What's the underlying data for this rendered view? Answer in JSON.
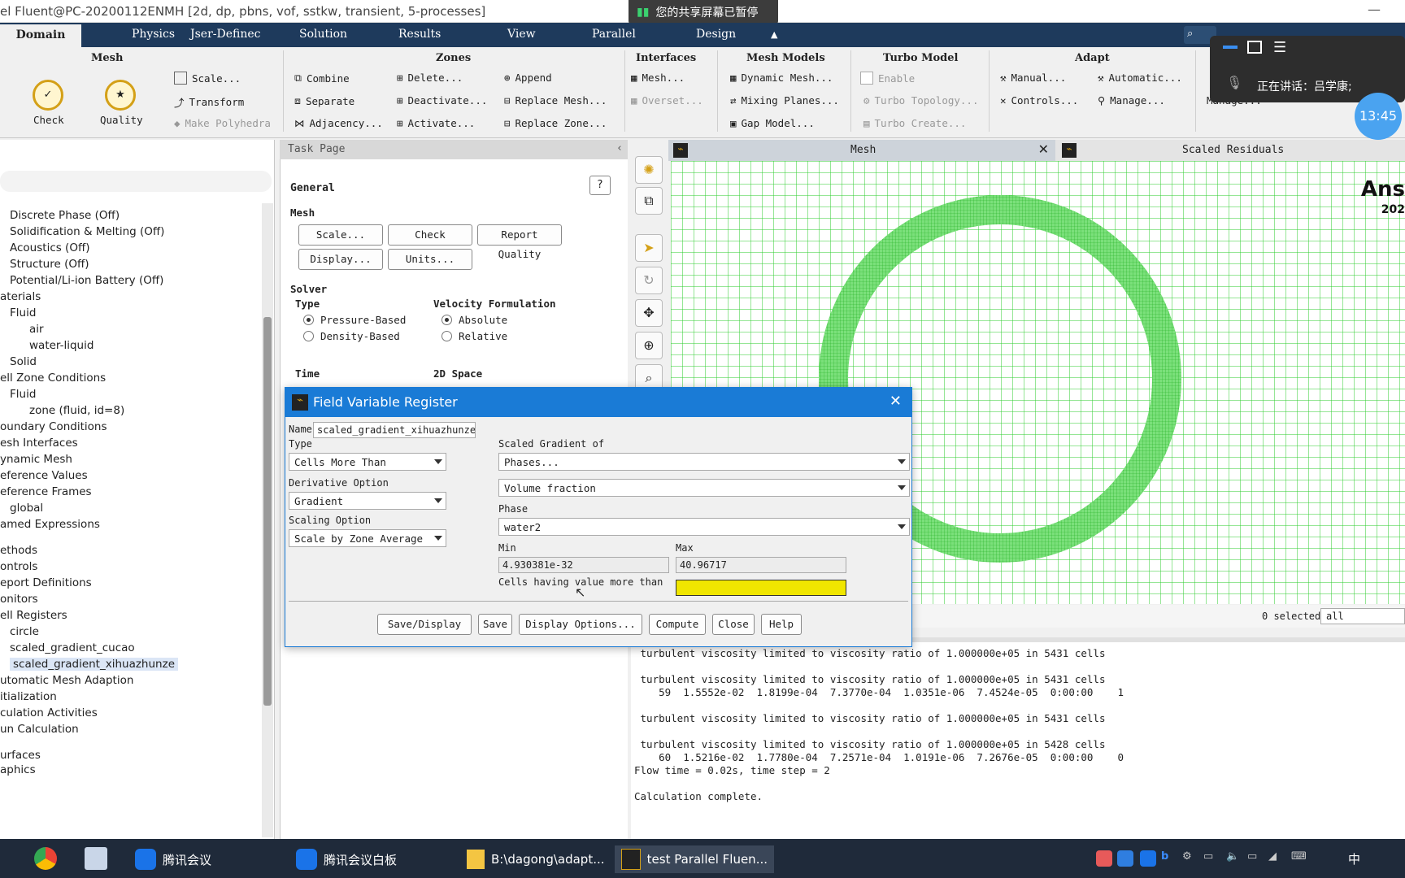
{
  "window": {
    "title": "el Fluent@PC-20200112ENMH  [2d, dp, pbns, vof, sstkw, transient, 5-processes]"
  },
  "share_banner": "您的共享屏幕已暂停",
  "menu": {
    "items": [
      "Domain",
      "Physics",
      "Jser-Definec",
      "Solution",
      "Results",
      "View",
      "Parallel",
      "Design"
    ]
  },
  "ribbon": {
    "mesh": {
      "title": "Mesh",
      "check": "Check",
      "quality": "Quality",
      "scale": "Scale...",
      "transform": "Transform",
      "make_polyhedra": "Make Polyhedra"
    },
    "zones": {
      "title": "Zones",
      "combine": "Combine",
      "separate": "Separate",
      "adjacency": "Adjacency...",
      "delete": "Delete...",
      "deactivate": "Deactivate...",
      "activate": "Activate...",
      "append": "Append",
      "replace_mesh": "Replace Mesh...",
      "replace_zone": "Replace Zone..."
    },
    "interfaces": {
      "title": "Interfaces",
      "mesh": "Mesh...",
      "overset": "Overset..."
    },
    "mesh_models": {
      "title": "Mesh Models",
      "dynamic": "Dynamic Mesh...",
      "mixing": "Mixing Planes...",
      "gap": "Gap Model..."
    },
    "turbo": {
      "title": "Turbo Model",
      "enable": "Enable",
      "topology": "Turbo Topology...",
      "create": "Turbo Create..."
    },
    "adapt": {
      "title": "Adapt",
      "manual": "Manual...",
      "automatic": "Automatic...",
      "controls": "Controls...",
      "manage": "Manage...",
      "manage2": "Manage..."
    }
  },
  "overlay": {
    "speaking": "正在讲话：吕学康;",
    "clock": "13:45"
  },
  "tree": {
    "items": [
      "Discrete Phase (Off)",
      "Solidification & Melting (Off)",
      "Acoustics (Off)",
      "Structure (Off)",
      "Potential/Li-ion Battery (Off)",
      "aterials",
      "Fluid",
      "air",
      "water-liquid",
      "Solid",
      "ell Zone Conditions",
      "Fluid",
      "zone (fluid, id=8)",
      "oundary Conditions",
      "esh Interfaces",
      "ynamic Mesh",
      "eference Values",
      "eference Frames",
      "global",
      "amed Expressions",
      "ethods",
      "ontrols",
      "eport Definitions",
      "onitors",
      "ell Registers",
      "circle",
      "scaled_gradient_cucao",
      "scaled_gradient_xihuazhunze",
      "utomatic Mesh Adaption",
      "itialization",
      "culation Activities",
      "un Calculation",
      "urfaces",
      "aphics"
    ]
  },
  "task": {
    "header": "Task Page",
    "general": "General",
    "mesh_label": "Mesh",
    "buttons": {
      "scale": "Scale...",
      "check": "Check",
      "report_quality": "Report Quality",
      "display": "Display...",
      "units": "Units..."
    },
    "solver": "Solver",
    "type": "Type",
    "pressure_based": "Pressure-Based",
    "density_based": "Density-Based",
    "velocity_formulation": "Velocity Formulation",
    "absolute": "Absolute",
    "relative": "Relative",
    "time": "Time",
    "space": "2D Space"
  },
  "graphics": {
    "tab_mesh": "Mesh",
    "tab_residuals": "Scaled Residuals",
    "brand": "Ans",
    "brand_sub": "202",
    "selected": "0 selected",
    "filter": "all"
  },
  "console": {
    "text": " turbulent viscosity limited to viscosity ratio of 1.000000e+05 in 5431 cells\n\n turbulent viscosity limited to viscosity ratio of 1.000000e+05 in 5431 cells\n    59  1.5552e-02  1.8199e-04  7.3770e-04  1.0351e-06  7.4524e-05  0:00:00    1\n\n turbulent viscosity limited to viscosity ratio of 1.000000e+05 in 5431 cells\n\n turbulent viscosity limited to viscosity ratio of 1.000000e+05 in 5428 cells\n    60  1.5216e-02  1.7780e-04  7.2571e-04  1.0191e-06  7.2676e-05  0:00:00    0\nFlow time = 0.02s, time step = 2\n\nCalculation complete."
  },
  "dialog": {
    "title": "Field Variable Register",
    "name_label": "Name",
    "name_value": "scaled_gradient_xihuazhunze",
    "type_label": "Type",
    "type_value": "Cells More Than",
    "deriv_label": "Derivative Option",
    "deriv_value": "Gradient",
    "scaling_label": "Scaling Option",
    "scaling_value": "Scale by Zone Average",
    "sgo_label": "Scaled Gradient of",
    "sgo_value": "Phases...",
    "sgo_value2": "Volume fraction",
    "phase_label": "Phase",
    "phase_value": "water2",
    "min_label": "Min",
    "min_value": "4.930381e-32",
    "max_label": "Max",
    "max_value": "40.96717",
    "cells_label": "Cells having value more than",
    "cells_value": "",
    "buttons": {
      "save_display": "Save/Display",
      "save": "Save",
      "display_options": "Display Options...",
      "compute": "Compute",
      "close": "Close",
      "help": "Help"
    }
  },
  "taskbar": {
    "tencent": "腾讯会议",
    "whiteboard": "腾讯会议白板",
    "folder": "B:\\dagong\\adapt...",
    "fluent": "test Parallel Fluen..."
  },
  "tray": {
    "ime": "中"
  },
  "colors": {
    "menubar": "#1e3a5c",
    "dialog_title": "#1a7bd6",
    "mesh_green": "#33cc33",
    "highlight": "#f0e600"
  }
}
